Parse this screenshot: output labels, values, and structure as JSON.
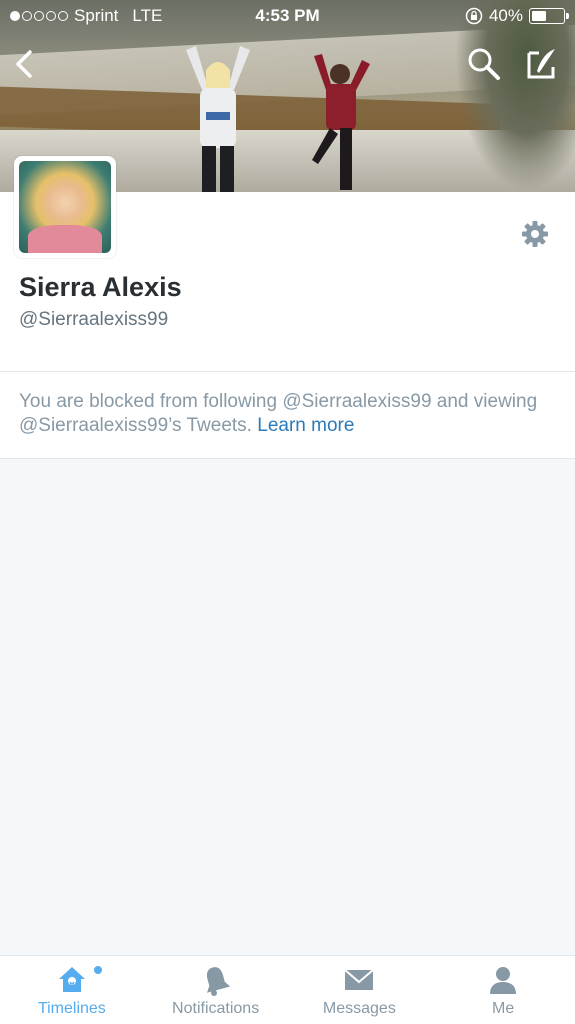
{
  "status_bar": {
    "carrier": "Sprint",
    "network": "LTE",
    "time": "4:53 PM",
    "battery": "40%",
    "battery_level": 0.4,
    "signal_bars_filled": 1
  },
  "header": {
    "back_icon": "chevron-left-icon",
    "search_icon": "search-icon",
    "compose_icon": "compose-tweet-icon"
  },
  "profile": {
    "name": "Sierra Alexis",
    "handle": "@Sierraalexiss99",
    "settings_icon": "gear-icon"
  },
  "notice": {
    "text": "You are blocked from following @Sierraalexiss99 and viewing @Sierraalexiss99’s Tweets.",
    "link": "Learn more"
  },
  "tabbar": {
    "tabs": [
      {
        "label": "Timelines",
        "icon": "home-icon",
        "active": true
      },
      {
        "label": "Notifications",
        "icon": "bell-icon",
        "active": false
      },
      {
        "label": "Messages",
        "icon": "envelope-icon",
        "active": false
      },
      {
        "label": "Me",
        "icon": "person-icon",
        "active": false
      }
    ]
  },
  "colors": {
    "accent": "#55acee",
    "link": "#2b7bb9",
    "muted": "#8899a6",
    "text": "#292f33"
  }
}
